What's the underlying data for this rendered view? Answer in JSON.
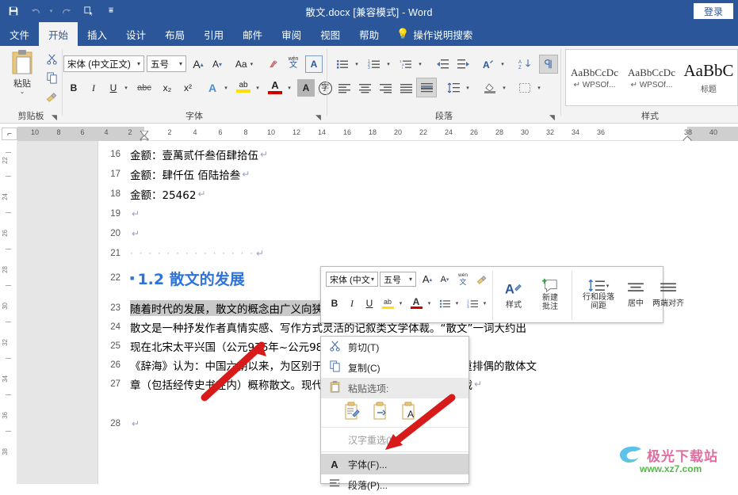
{
  "titlebar": {
    "document_title": "散文.docx [兼容模式]  -  Word",
    "signin_label": "登录",
    "qat": [
      {
        "name": "save-icon",
        "glyph": "💾"
      },
      {
        "name": "undo-icon",
        "glyph": "↶"
      },
      {
        "name": "undo-dropdown-icon",
        "glyph": "▾"
      },
      {
        "name": "redo-icon",
        "glyph": "↻"
      },
      {
        "name": "touch-mode-icon",
        "glyph": "✐"
      },
      {
        "name": "customize-qat-icon",
        "glyph": "☰"
      }
    ]
  },
  "tabs": [
    {
      "label": "文件",
      "active": false
    },
    {
      "label": "开始",
      "active": true
    },
    {
      "label": "插入",
      "active": false
    },
    {
      "label": "设计",
      "active": false
    },
    {
      "label": "布局",
      "active": false
    },
    {
      "label": "引用",
      "active": false
    },
    {
      "label": "邮件",
      "active": false
    },
    {
      "label": "审阅",
      "active": false
    },
    {
      "label": "视图",
      "active": false
    },
    {
      "label": "帮助",
      "active": false
    }
  ],
  "tellme": {
    "label": "操作说明搜索",
    "icon": "lightbulb-icon"
  },
  "ribbon": {
    "clipboard": {
      "group_label": "剪贴板",
      "paste_label": "粘贴",
      "cut_icon": "scissors-icon",
      "copy_icon": "copy-icon",
      "format_painter_icon": "format-painter-icon"
    },
    "font": {
      "group_label": "字体",
      "font_name": "宋体 (中文正文)",
      "font_size": "五号",
      "grow_font": "A",
      "shrink_font": "A",
      "change_case": "Aa",
      "clear_formatting_icon": "clear-formatting-icon",
      "phonetic_guide": "wén",
      "character_border": "A",
      "bold": "B",
      "italic": "I",
      "underline": "U",
      "strikethrough": "abc",
      "subscript": "x₂",
      "superscript": "x²",
      "text_effects": "A",
      "highlight": "ab",
      "font_color": "A",
      "shading_char": "A",
      "enclose_char": "字"
    },
    "paragraph": {
      "group_label": "段落",
      "bullets_icon": "bullet-list-icon",
      "numbering_icon": "numbered-list-icon",
      "multilevel_icon": "multilevel-list-icon",
      "decrease_indent_icon": "decrease-indent-icon",
      "increase_indent_icon": "increase-indent-icon",
      "sort_asian_icon": "asian-layout-icon",
      "sort_icon": "sort-az-icon",
      "show_marks_icon": "show-paragraph-marks-icon",
      "align_left_icon": "align-left-icon",
      "align_center_icon": "align-center-icon",
      "align_right_icon": "align-right-icon",
      "distribute_icon": "distribute-icon",
      "justify_icon": "justify-icon",
      "line_spacing_icon": "line-spacing-icon",
      "shading_icon": "shading-icon",
      "borders_icon": "borders-icon"
    },
    "styles": {
      "group_label": "样式",
      "items": [
        {
          "preview": "AaBbCcDc",
          "name": "↵ WPSOf...",
          "size": "small"
        },
        {
          "preview": "AaBbCcDc",
          "name": "↵ WPSOf...",
          "size": "small"
        },
        {
          "preview": "AaBbC",
          "name": "标题",
          "size": "large"
        }
      ]
    }
  },
  "rulers": {
    "horizontal": [
      "10",
      "8",
      "6",
      "4",
      "2",
      "2",
      "4",
      "6",
      "8",
      "10",
      "12",
      "14",
      "16",
      "18",
      "20",
      "22",
      "24",
      "26",
      "28",
      "30",
      "32",
      "34",
      "36",
      "38",
      "40"
    ],
    "vertical": [
      "22",
      "24",
      "26",
      "28",
      "30",
      "32",
      "34",
      "36",
      "38"
    ],
    "corner_icon": "tab-stop-icon"
  },
  "document": {
    "lines": [
      {
        "num": "16",
        "text": "金额：壹萬贰仟叁佰肆拾伍",
        "mark": "↵",
        "type": "body"
      },
      {
        "num": "17",
        "text": "金额：肆仟伍 佰陆拾叁",
        "mark": "↵",
        "type": "body"
      },
      {
        "num": "18",
        "text": "金额：25462",
        "mark": "↵",
        "type": "body"
      },
      {
        "num": "19",
        "text": "",
        "mark": "↵",
        "type": "body"
      },
      {
        "num": "20",
        "text": "",
        "mark": "↵",
        "type": "body"
      },
      {
        "num": "21",
        "text": "· · · · · · · · · · · · · ·",
        "mark": "↵",
        "type": "dots"
      },
      {
        "num": "22",
        "text": "1.2 散文的发展",
        "mark": "",
        "type": "heading"
      },
      {
        "num": "23",
        "text": "随着时代的发展，散文的概念由广义向狭义转变，并受到西方文化的影响。",
        "mark": "↵",
        "type": "selected"
      },
      {
        "num": "24",
        "text": "散文是一种抒发作者真情实感、写作方式灵活的记叙类文学体裁。“散文”一词大约出",
        "mark": "",
        "type": "body"
      },
      {
        "num": "25",
        "text": "现在北宋太平兴国（公元976年~公元983年）时期。",
        "mark": "↵",
        "type": "body"
      },
      {
        "num": "26",
        "text": "《辞海》认为：中国六朝以来，为区别于韵文、骈文，把凡不押韵、不重排偶的散体文",
        "mark": "",
        "type": "body"
      },
      {
        "num": "27",
        "text": "章（包括经传史书在内）概称散文。现代散文指诗歌以外的所有文学体裁",
        "mark": "↵",
        "type": "body"
      },
      {
        "num": "28",
        "text": "",
        "mark": "↵",
        "type": "body"
      }
    ]
  },
  "mini_toolbar": {
    "font_name": "宋体 (中文",
    "font_size": "五号",
    "grow_font": "A",
    "shrink_font": "A",
    "phonetic": "wén",
    "format_painter_icon": "format-painter-icon",
    "bold": "B",
    "italic": "I",
    "underline": "U",
    "highlight": "ab",
    "font_color": "A",
    "bullets_icon": "bullet-list-icon",
    "numbering_icon": "numbered-list-icon",
    "styles_label": "样式",
    "new_comment_label": "新建\n批注",
    "new_comment_line1": "新建",
    "new_comment_line2": "批注",
    "line_spacing_line1": "行和段落",
    "line_spacing_line2": "间距",
    "center_label": "居中",
    "justify_label": "两端对齐"
  },
  "context_menu": {
    "items": [
      {
        "label": "剪切(T)",
        "icon": "scissors-icon",
        "state": "normal"
      },
      {
        "label": "复制(C)",
        "icon": "copy-icon",
        "state": "normal"
      },
      {
        "label": "粘贴选项:",
        "icon": "paste-icon",
        "state": "header"
      },
      {
        "label": "汉字重选(V)",
        "icon": "",
        "state": "disabled"
      },
      {
        "label": "字体(F)...",
        "icon": "font-icon",
        "state": "highlighted"
      },
      {
        "label": "段落(P)...",
        "icon": "paragraph-icon",
        "state": "normal"
      }
    ],
    "paste_options": [
      {
        "name": "keep-source-formatting-icon"
      },
      {
        "name": "merge-formatting-icon"
      },
      {
        "name": "keep-text-only-icon"
      }
    ]
  },
  "annotations": {
    "arrows": [
      {
        "name": "arrow-to-selected-line"
      },
      {
        "name": "arrow-to-font-menu-item"
      }
    ],
    "arrow_color": "#d71a1a"
  },
  "watermark": {
    "brand_cn": "极光下载站",
    "url": "www.xz7.com",
    "logo_icon": "aurora-logo-icon"
  },
  "colors": {
    "title_bar": "#2b579a",
    "ribbon_bg": "#f3f3f3",
    "heading_blue": "#2e74d8",
    "selection_gray": "#c9c9c9",
    "workspace_gray": "#e6e6e6"
  }
}
